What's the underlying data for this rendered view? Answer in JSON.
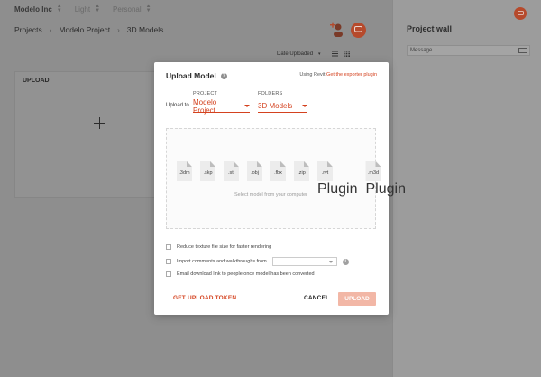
{
  "topnav": {
    "org": "Modelo Inc",
    "theme": "Light",
    "workspace": "Personal"
  },
  "breadcrumb": [
    "Projects",
    "Modelo Project",
    "3D Models"
  ],
  "sortbar": {
    "sort_label": "Date Uploaded"
  },
  "upload_card": {
    "label": "UPLOAD"
  },
  "sidebar": {
    "title": "Project wall",
    "message_placeholder": "Message"
  },
  "modal": {
    "title": "Upload Model",
    "revit_prefix": "Using Revit",
    "revit_link": "Get the exporter plugin",
    "project_label": "PROJECT",
    "folders_label": "FOLDERS",
    "upload_to_label": "Upload to",
    "project_value": "Modelo Project",
    "folder_value": "3D Models",
    "file_types": [
      {
        "ext": ".3dm",
        "plugin": ""
      },
      {
        "ext": ".skp",
        "plugin": ""
      },
      {
        "ext": ".stl",
        "plugin": ""
      },
      {
        "ext": ".obj",
        "plugin": ""
      },
      {
        "ext": ".fbx",
        "plugin": ""
      },
      {
        "ext": ".zip",
        "plugin": ""
      },
      {
        "ext": ".rvt",
        "plugin": "Plugin"
      },
      {
        "ext": ".m3d",
        "plugin": "Plugin"
      }
    ],
    "dropzone_hint": "Select model from your computer",
    "option_reduce_texture": "Reduce texture file size for faster rendering",
    "option_import_comments": "Import comments and walkthroughs from",
    "option_email_link": "Email download link to people once model has been converted",
    "get_token_label": "GET UPLOAD TOKEN",
    "cancel_label": "CANCEL",
    "upload_label": "UPLOAD"
  },
  "colors": {
    "accent": "#d4421f",
    "upload_disabled": "#f2b7a6",
    "overlay": "#8e8e8e"
  }
}
